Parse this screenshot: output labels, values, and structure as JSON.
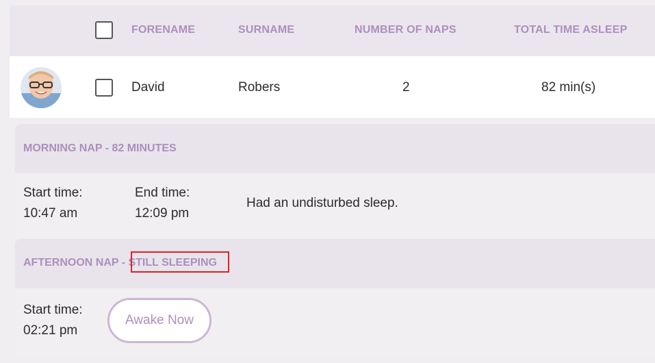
{
  "table": {
    "headers": {
      "forename": "FORENAME",
      "surname": "SURNAME",
      "naps": "NUMBER OF NAPS",
      "total": "TOTAL TIME ASLEEP"
    },
    "row": {
      "forename": "David",
      "surname": "Robers",
      "naps": "2",
      "total": "82 min(s)"
    }
  },
  "naps": {
    "morning": {
      "title": "MORNING NAP - 82 MINUTES",
      "start_label": "Start time:",
      "start_value": "10:47 am",
      "end_label": "End time:",
      "end_value": "12:09 pm",
      "note": "Had an undisturbed sleep."
    },
    "afternoon": {
      "title_prefix": "AFTERNOON NAP - ",
      "title_status": "STILL SLEEPING",
      "start_label": "Start time:",
      "start_value": "02:21 pm",
      "awake_button": "Awake Now"
    }
  },
  "colors": {
    "accent": "#ac8fbd",
    "highlight": "#e01f26"
  }
}
